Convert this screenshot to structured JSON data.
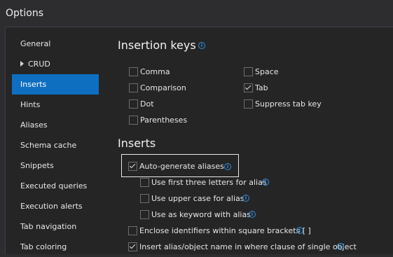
{
  "window": {
    "title": "Options"
  },
  "nav": {
    "items": [
      {
        "label": "General",
        "expandable": false,
        "selected": false
      },
      {
        "label": "CRUD",
        "expandable": true,
        "selected": false
      },
      {
        "label": "Inserts",
        "expandable": false,
        "selected": true
      },
      {
        "label": "Hints",
        "expandable": false,
        "selected": false
      },
      {
        "label": "Aliases",
        "expandable": false,
        "selected": false
      },
      {
        "label": "Schema cache",
        "expandable": false,
        "selected": false
      },
      {
        "label": "Snippets",
        "expandable": false,
        "selected": false
      },
      {
        "label": "Executed queries",
        "expandable": false,
        "selected": false
      },
      {
        "label": "Execution alerts",
        "expandable": false,
        "selected": false
      },
      {
        "label": "Tab navigation",
        "expandable": false,
        "selected": false
      },
      {
        "label": "Tab coloring",
        "expandable": false,
        "selected": false
      }
    ]
  },
  "insertion_keys": {
    "title": "Insertion keys",
    "options": [
      {
        "label": "Comma",
        "checked": false
      },
      {
        "label": "Comparison",
        "checked": false
      },
      {
        "label": "Dot",
        "checked": false
      },
      {
        "label": "Parentheses",
        "checked": false
      },
      {
        "label": "Space",
        "checked": false
      },
      {
        "label": "Tab",
        "checked": true
      },
      {
        "label": "Suppress tab key",
        "checked": false
      }
    ]
  },
  "inserts": {
    "title": "Inserts",
    "options": [
      {
        "label": "Auto-generate aliases",
        "checked": true
      },
      {
        "label": "Use first three letters for alias",
        "checked": false
      },
      {
        "label": "Use upper case for alias",
        "checked": false
      },
      {
        "label": "Use as keyword with alias",
        "checked": false
      },
      {
        "label": "Enclose identifiers within square brackets [ ]",
        "checked": false
      },
      {
        "label": "Insert alias/object name in where clause of single object",
        "checked": true
      }
    ]
  },
  "colors": {
    "accent": "#0e6fc1",
    "info": "#2f8fe0",
    "background": "#252526"
  },
  "icons": {
    "info": "info-icon",
    "expand": "chevron-right-icon",
    "check": "check-icon"
  }
}
